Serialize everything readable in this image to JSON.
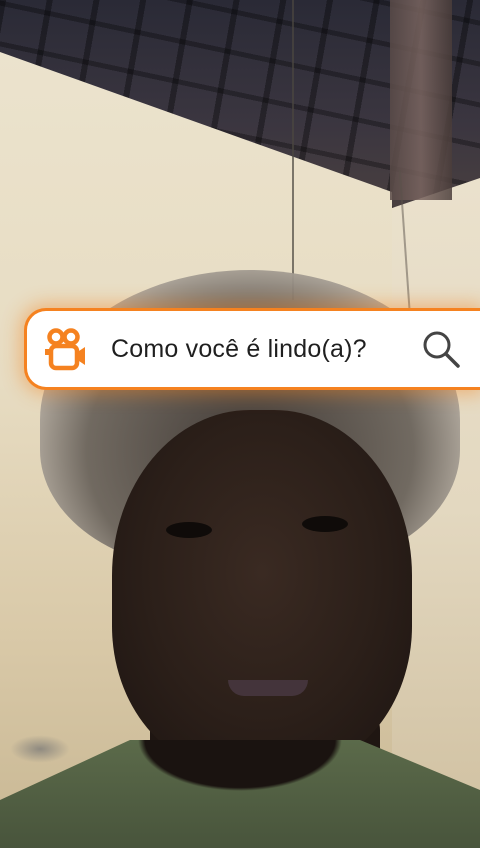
{
  "filter": {
    "query": "Como você é lindo(a)?",
    "logo_icon": "kwai-camera-logo-icon",
    "search_icon": "search-icon",
    "accent_color": "#f58220"
  }
}
